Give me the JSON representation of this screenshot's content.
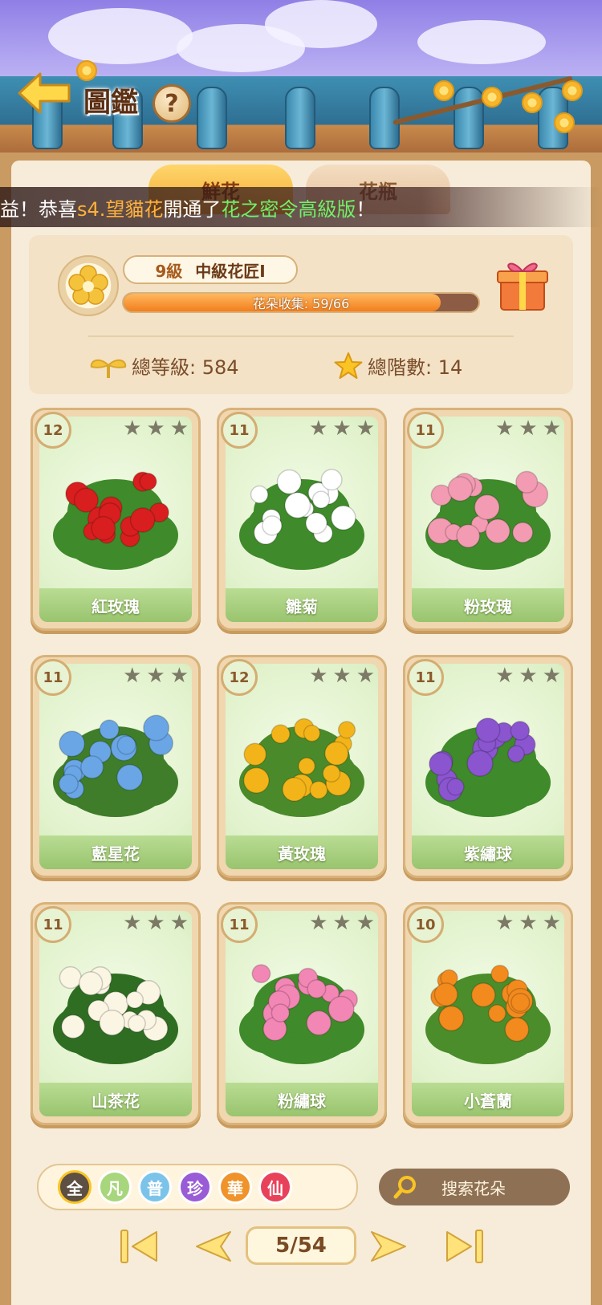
{
  "header": {
    "title": "圖鑑",
    "help_label": "?"
  },
  "tabs": [
    {
      "label": "鮮花",
      "active": true
    },
    {
      "label": "花瓶",
      "active": false
    }
  ],
  "marquee": {
    "prefix": "益！恭喜 ",
    "player": "s4.望貓花",
    "middle": " 開通了 ",
    "item": "花之密令高級版",
    "suffix": " ！"
  },
  "profile": {
    "level": "9級",
    "rank": "中級花匠Ⅰ",
    "collection_label": "花朵收集: 59/66",
    "collected": 59,
    "total": 66,
    "total_level_label": "總等級: 584",
    "total_tier_label": "總階數: 14"
  },
  "cards": [
    {
      "name": "紅玫瑰",
      "level": "12",
      "stars": 3,
      "flower_color": "#d81e1e",
      "leaf_color": "#3f8a2a"
    },
    {
      "name": "雛菊",
      "level": "11",
      "stars": 3,
      "flower_color": "#ffffff",
      "leaf_color": "#3f8a2a"
    },
    {
      "name": "粉玫瑰",
      "level": "11",
      "stars": 3,
      "flower_color": "#f39bb3",
      "leaf_color": "#3f8a2a"
    },
    {
      "name": "藍星花",
      "level": "11",
      "stars": 3,
      "flower_color": "#6aa6e6",
      "leaf_color": "#3f7d2a"
    },
    {
      "name": "黃玫瑰",
      "level": "12",
      "stars": 3,
      "flower_color": "#f3b419",
      "leaf_color": "#4a8a2a"
    },
    {
      "name": "紫繡球",
      "level": "11",
      "stars": 3,
      "flower_color": "#8a55cf",
      "leaf_color": "#3f8a2a"
    },
    {
      "name": "山茶花",
      "level": "11",
      "stars": 3,
      "flower_color": "#fbf5e4",
      "leaf_color": "#2f6e22"
    },
    {
      "name": "粉繡球",
      "level": "11",
      "stars": 3,
      "flower_color": "#f286b4",
      "leaf_color": "#3f8a2a"
    },
    {
      "name": "小蒼蘭",
      "level": "10",
      "stars": 3,
      "flower_color": "#f28a1e",
      "leaf_color": "#4b8d2a"
    }
  ],
  "filters": [
    {
      "label": "全",
      "color": "#5d4f43",
      "selected": true
    },
    {
      "label": "凡",
      "color": "#a8d67c",
      "selected": false
    },
    {
      "label": "普",
      "color": "#7cc3ea",
      "selected": false
    },
    {
      "label": "珍",
      "color": "#9a5bd6",
      "selected": false
    },
    {
      "label": "華",
      "color": "#f0932a",
      "selected": false
    },
    {
      "label": "仙",
      "color": "#e8425b",
      "selected": false
    }
  ],
  "search": {
    "placeholder": "搜索花朵"
  },
  "pagination": {
    "label": "5/54"
  }
}
